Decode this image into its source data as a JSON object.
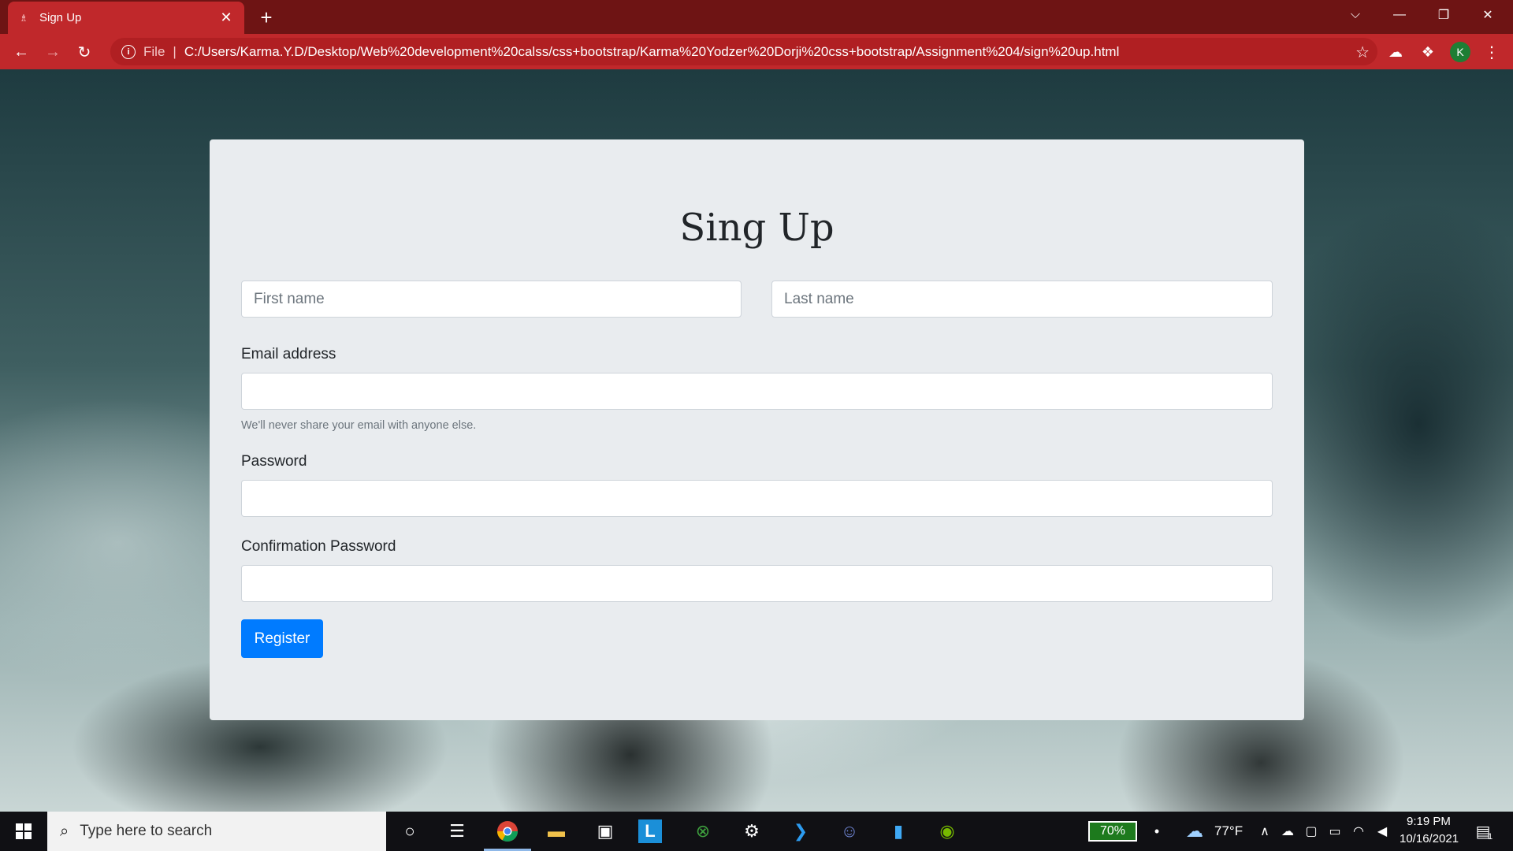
{
  "browser": {
    "tab_title": "Sign Up",
    "address_scheme_label": "File",
    "address_url": "C:/Users/Karma.Y.D/Desktop/Web%20development%20calss/css+bootstrap/Karma%20Yodzer%20Dorji%20css+bootstrap/Assignment%204/sign%20up.html",
    "profile_initial": "K"
  },
  "form": {
    "title": "Sing Up",
    "first_name_placeholder": "First name",
    "last_name_placeholder": "Last name",
    "email_label": "Email address",
    "email_help": "We'll never share your email with anyone else.",
    "password_label": "Password",
    "confirm_password_label": "Confirmation Password",
    "register_label": "Register"
  },
  "taskbar": {
    "search_placeholder": "Type here to search",
    "battery_percent": "70%",
    "weather_temp": "77°F",
    "time": "9:19 PM",
    "date": "10/16/2021",
    "notification_count": "1"
  },
  "colors": {
    "tab_active": "#c0282b",
    "tabbar": "#6e1414",
    "primary_button": "#007bff",
    "card_bg": "#e9ecef"
  }
}
